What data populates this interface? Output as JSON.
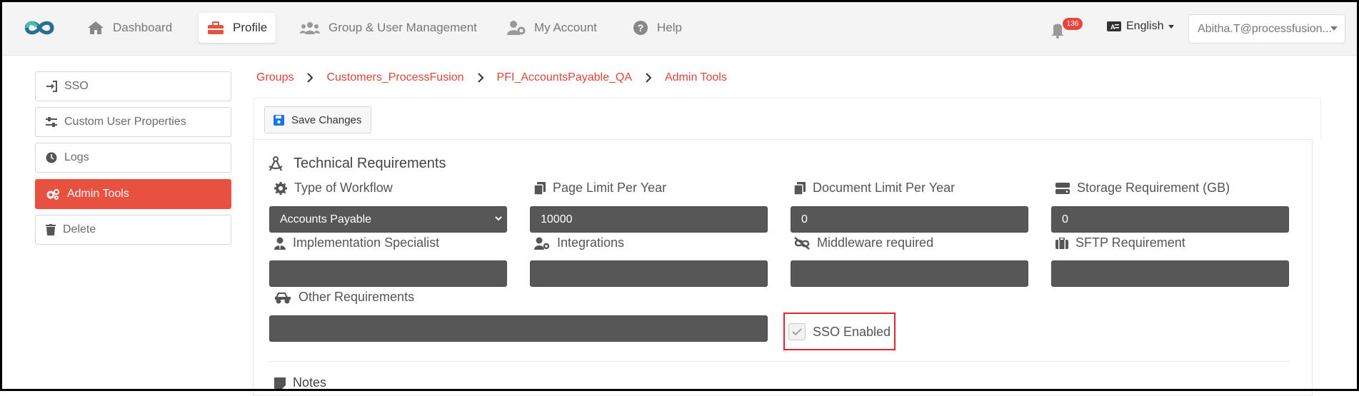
{
  "nav": {
    "items": [
      {
        "label": "Dashboard",
        "icon": "home-icon"
      },
      {
        "label": "Profile",
        "icon": "toolbox-icon"
      },
      {
        "label": "Group & User Management",
        "icon": "users-icon"
      },
      {
        "label": "My Account",
        "icon": "user-gear-icon"
      },
      {
        "label": "Help",
        "icon": "question-circle-icon"
      }
    ],
    "active": "Profile",
    "notification_count": "136",
    "language": "English",
    "user": "Abitha.T@processfusion..."
  },
  "sidebar": {
    "items": [
      {
        "label": "SSO",
        "icon": "sign-in-icon"
      },
      {
        "label": "Custom User Properties",
        "icon": "sliders-icon"
      },
      {
        "label": "Logs",
        "icon": "clock-icon"
      },
      {
        "label": "Admin Tools",
        "icon": "cogs-icon"
      },
      {
        "label": "Delete",
        "icon": "trash-icon"
      }
    ],
    "active": "Admin Tools"
  },
  "breadcrumb": [
    "Groups",
    "Customers_ProcessFusion",
    "PFI_AccountsPayable_QA",
    "Admin Tools"
  ],
  "toolbar": {
    "save_label": "Save Changes"
  },
  "section": {
    "title": "Technical Requirements"
  },
  "fields": {
    "workflow": {
      "label": "Type of Workflow",
      "value": "Accounts Payable"
    },
    "page_limit": {
      "label": "Page Limit Per Year",
      "value": "10000"
    },
    "doc_limit": {
      "label": "Document Limit Per Year",
      "value": "0"
    },
    "storage": {
      "label": "Storage Requirement (GB)",
      "value": "0"
    },
    "impl_specialist": {
      "label": "Implementation Specialist",
      "value": ""
    },
    "integrations": {
      "label": "Integrations",
      "value": ""
    },
    "middleware": {
      "label": "Middleware required",
      "value": ""
    },
    "sftp": {
      "label": "SFTP Requirement",
      "value": ""
    },
    "other": {
      "label": "Other Requirements",
      "value": ""
    }
  },
  "sso": {
    "label": "SSO Enabled",
    "checked": true
  },
  "notes": {
    "label": "Notes"
  },
  "colors": {
    "accent": "#e8503f",
    "input_bg": "#575757",
    "highlight_border": "#e0242d"
  }
}
